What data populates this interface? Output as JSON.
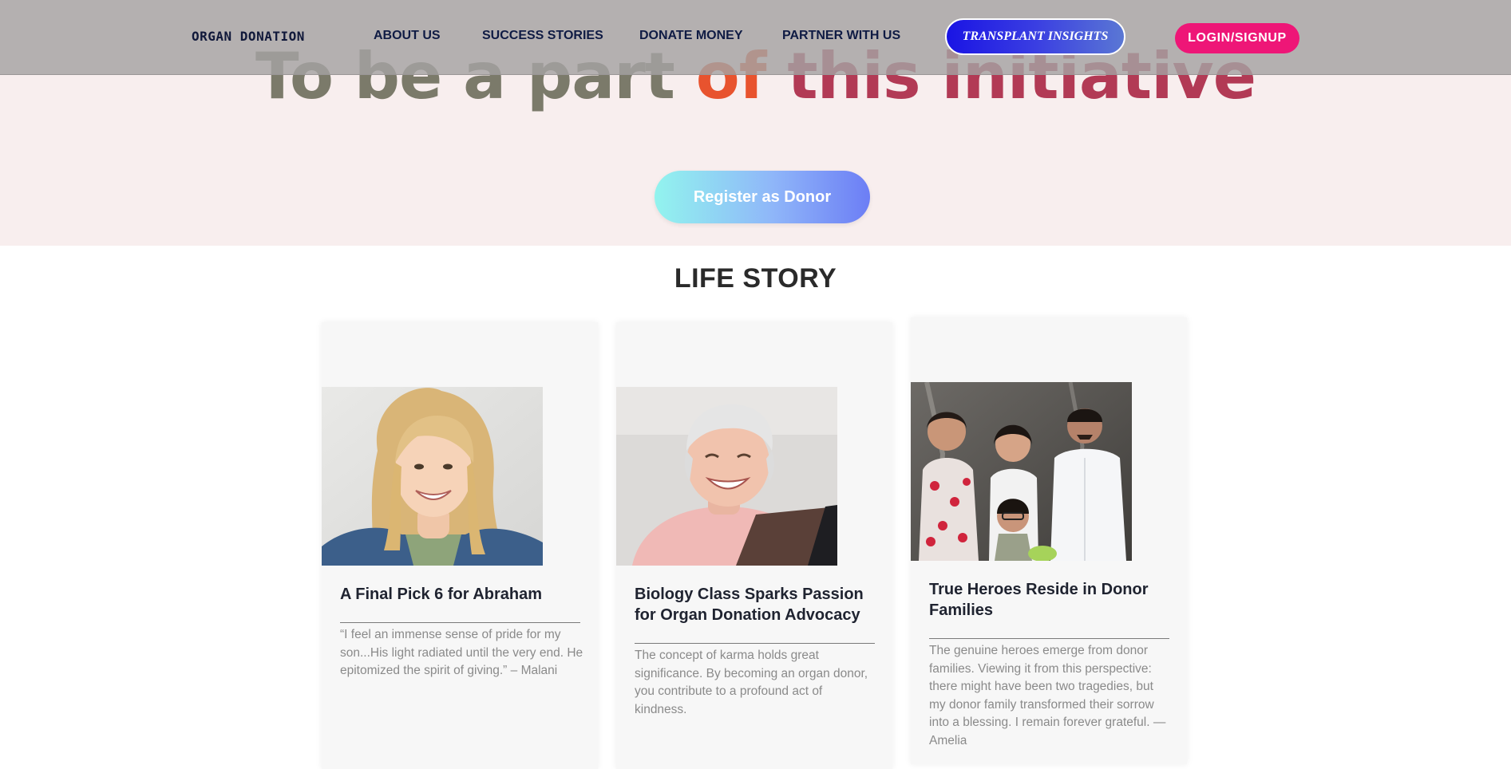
{
  "navbar": {
    "brand": "ORGAN DONATION",
    "links": [
      "ABOUT US",
      "SUCCESS STORIES",
      "DONATE MONEY",
      "PARTNER WITH US"
    ],
    "insights_button": "TRANSPLANT INSIGHTS",
    "login_button": "LOGIN/SIGNUP"
  },
  "hero": {
    "title_part1": "To be a part ",
    "title_part2": "of",
    "title_part3": " this initiative",
    "register_button": "Register as Donor",
    "colors": {
      "background": "#f8eeee",
      "title_start": "#7b7a6a",
      "title_accent": "#e8532e",
      "title_end": "#b23a55"
    }
  },
  "life_story": {
    "heading": "LIFE STORY",
    "cards": [
      {
        "title": "A Final Pick 6 for Abraham",
        "text": "“I feel an immense sense of pride for my son...His light radiated until the very end. He epitomized the spirit of giving.” – Malani",
        "photo": "portrait-smiling-woman"
      },
      {
        "title": "Biology Class Sparks Passion for Organ Donation Advocacy",
        "text": "The concept of karma holds great significance. By becoming an organ donor, you contribute to a profound act of kindness.",
        "photo": "portrait-laughing-man"
      },
      {
        "title": "True Heroes Reside in Donor Families",
        "text": "The genuine heroes emerge from donor families. Viewing it from this perspective: there might have been two tragedies, but my donor family transformed their sorrow into a blessing. I remain forever grateful. — Amelia",
        "photo": "family-group-photo"
      }
    ]
  },
  "colors": {
    "navbar_overlay": "#a5a2a2",
    "nav_text": "#0f1b44",
    "login_pink": "#ee1677",
    "insights_blue": "#1a14e4"
  }
}
